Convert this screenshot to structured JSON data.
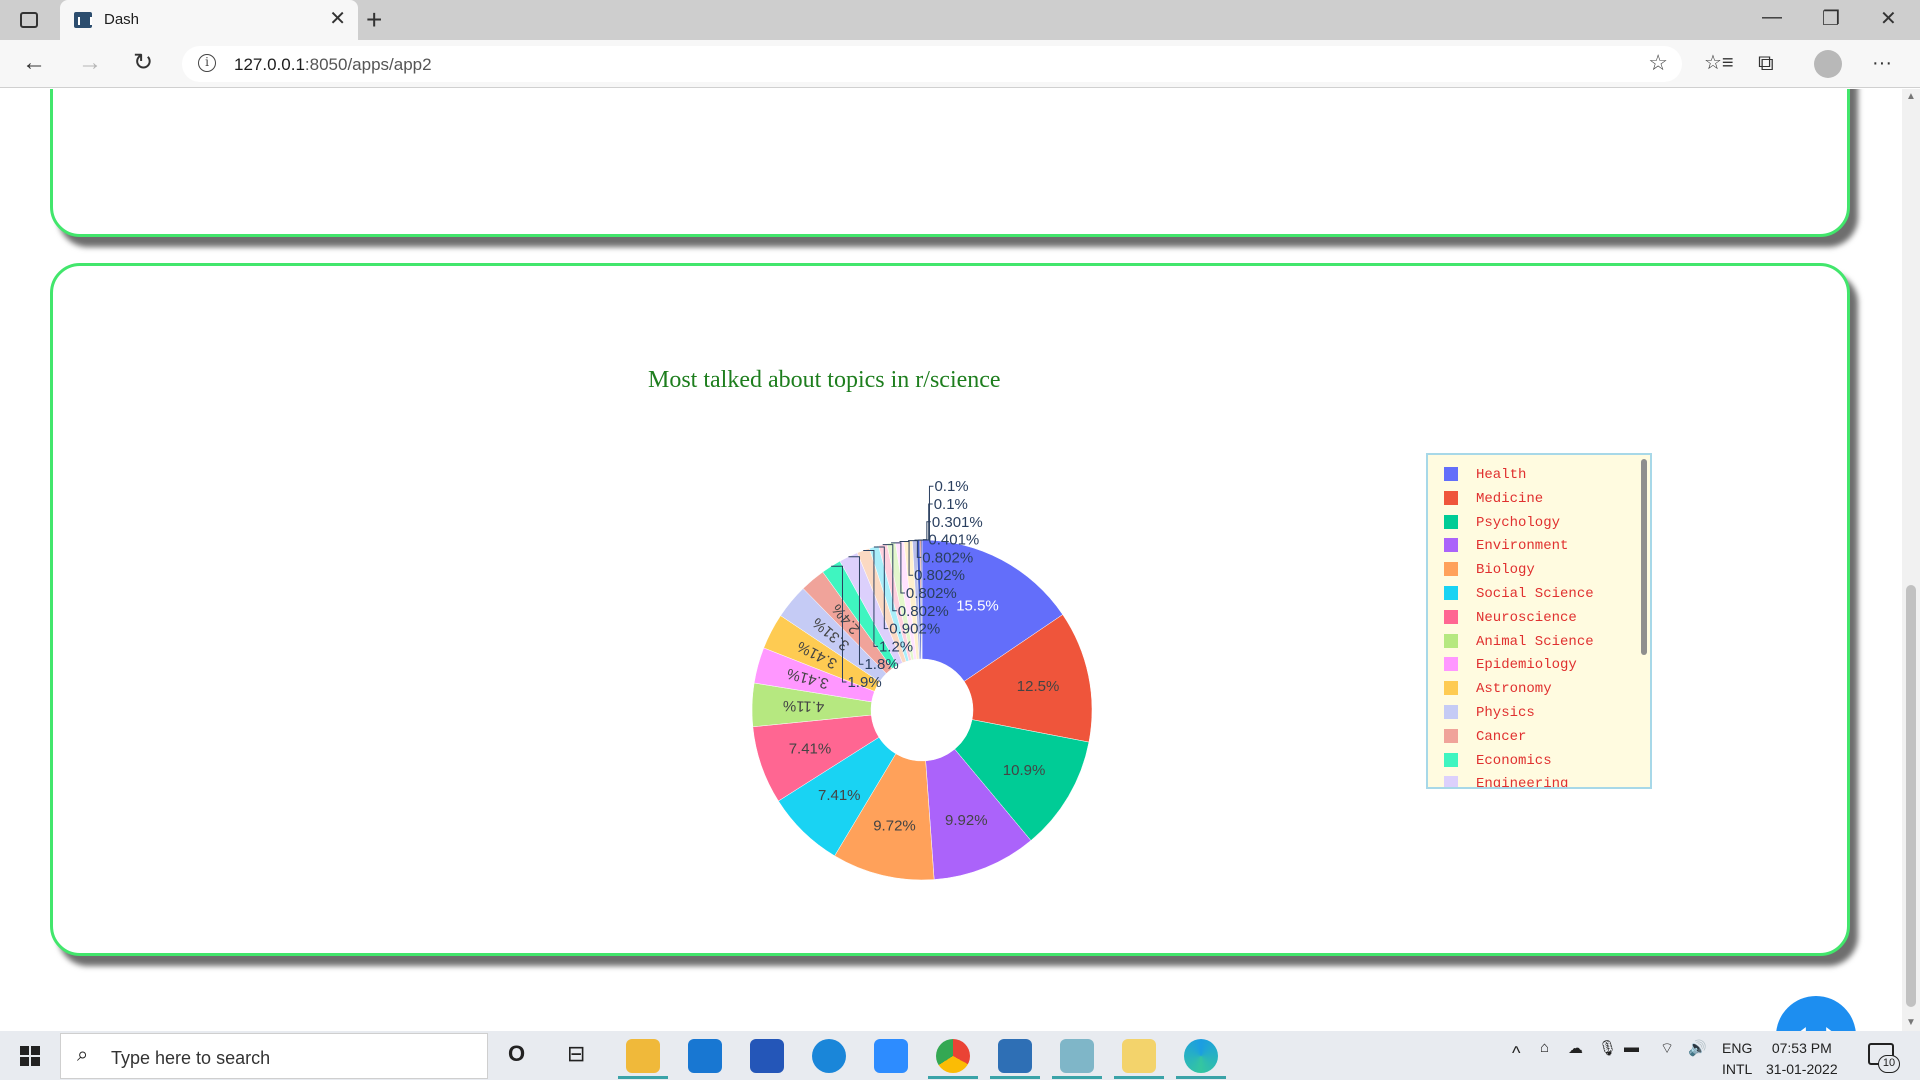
{
  "browser": {
    "tab_title": "Dash",
    "tab_close": "✕",
    "new_tab": "+",
    "url_host": "127.0.0.1",
    "url_rest": ":8050/apps/app2",
    "info_glyph": "i",
    "back_glyph": "←",
    "forward_glyph": "→",
    "refresh_glyph": "↻",
    "favorite_glyph": "☆",
    "favorites_glyph": "☆≡",
    "collections_glyph": "⧉",
    "menu_glyph": "···",
    "minimize_glyph": "—",
    "restore_glyph": "❐",
    "close_glyph": "✕"
  },
  "page": {
    "fab_glyph": "‹ ›"
  },
  "chart_data": {
    "type": "pie",
    "title": "Most talked about topics in r/science",
    "hole": 0.3,
    "slices": [
      {
        "label": "Health",
        "percent": 15.5,
        "text": "15.5%",
        "color": "#636efa",
        "textcolor": "#ffffff"
      },
      {
        "label": "Medicine",
        "percent": 12.5,
        "text": "12.5%",
        "color": "#ef553b",
        "textcolor": "#444444"
      },
      {
        "label": "Psychology",
        "percent": 10.9,
        "text": "10.9%",
        "color": "#00cc96",
        "textcolor": "#444444"
      },
      {
        "label": "Environment",
        "percent": 9.92,
        "text": "9.92%",
        "color": "#ab63fa",
        "textcolor": "#444444"
      },
      {
        "label": "Biology",
        "percent": 9.72,
        "text": "9.72%",
        "color": "#ffa15a",
        "textcolor": "#444444"
      },
      {
        "label": "Social Science",
        "percent": 7.41,
        "text": "7.41%",
        "color": "#19d3f3",
        "textcolor": "#444444"
      },
      {
        "label": "Neuroscience",
        "percent": 7.41,
        "text": "7.41%",
        "color": "#ff6692",
        "textcolor": "#444444"
      },
      {
        "label": "Animal Science",
        "percent": 4.11,
        "text": "4.11%",
        "color": "#b6e880",
        "textcolor": "#444444"
      },
      {
        "label": "Epidemiology",
        "percent": 3.41,
        "text": "3.41%",
        "color": "#ff97ff",
        "textcolor": "#444444"
      },
      {
        "label": "Astronomy",
        "percent": 3.41,
        "text": "3.41%",
        "color": "#fecb52",
        "textcolor": "#444444"
      },
      {
        "label": "Physics",
        "percent": 3.31,
        "text": "3.31%",
        "color": "#c5cbf5",
        "textcolor": "#444444"
      },
      {
        "label": "Cancer",
        "percent": 2.4,
        "text": "2.4%",
        "color": "#f0a39a",
        "textcolor": "#444444"
      },
      {
        "label": "Economics",
        "percent": 1.9,
        "text": "1.9%",
        "color": "#3ff5c0",
        "textcolor": "#444444"
      },
      {
        "label": "Engineering",
        "percent": 1.8,
        "text": "1.8%",
        "color": "#dcd0fc",
        "textcolor": "#444444"
      },
      {
        "label": "",
        "percent": 1.2,
        "text": "1.2%",
        "color": "#fbd9c2",
        "textcolor": "#444444"
      },
      {
        "label": "",
        "percent": 0.902,
        "text": "0.902%",
        "color": "#aaeefa",
        "textcolor": "#444444"
      },
      {
        "label": "",
        "percent": 0.802,
        "text": "0.802%",
        "color": "#ffd1de",
        "textcolor": "#444444"
      },
      {
        "label": "",
        "percent": 0.802,
        "text": "0.802%",
        "color": "#e3f7cd",
        "textcolor": "#444444"
      },
      {
        "label": "",
        "percent": 0.802,
        "text": "0.802%",
        "color": "#ffe3ff",
        "textcolor": "#444444"
      },
      {
        "label": "",
        "percent": 0.802,
        "text": "0.802%",
        "color": "#fff0cd",
        "textcolor": "#444444"
      },
      {
        "label": "",
        "percent": 0.401,
        "text": "0.401%",
        "color": "#b8bdeb",
        "textcolor": "#444444"
      },
      {
        "label": "",
        "percent": 0.301,
        "text": "0.301%",
        "color": "#3f56c6",
        "textcolor": "#444444"
      },
      {
        "label": "",
        "percent": 0.1,
        "text": "0.1%",
        "color": "#c63a2a",
        "textcolor": "#444444"
      },
      {
        "label": "",
        "percent": 0.1,
        "text": "0.1%",
        "color": "#2a3d8f",
        "textcolor": "#444444"
      }
    ],
    "legend": [
      "Health",
      "Medicine",
      "Psychology",
      "Environment",
      "Biology",
      "Social Science",
      "Neuroscience",
      "Animal Science",
      "Epidemiology",
      "Astronomy",
      "Physics",
      "Cancer",
      "Economics",
      "Engineering"
    ],
    "legend_placement": "right",
    "legend_text_color": "#e0302f",
    "legend_bg_color": "#fffbe0"
  },
  "taskbar": {
    "search_placeholder": "Type here to search",
    "search_glyph": "⌕",
    "cortana_glyph": "O",
    "taskview_glyph": "⊟",
    "lang_line1": "ENG",
    "lang_line2": "INTL",
    "time": "07:53 PM",
    "date": "31-01-2022",
    "notification_count": "10",
    "tray_chevron": "^",
    "tray_icons": [
      "⌂",
      "☁",
      "🎙",
      "▬",
      "⌔",
      "🔊"
    ]
  }
}
